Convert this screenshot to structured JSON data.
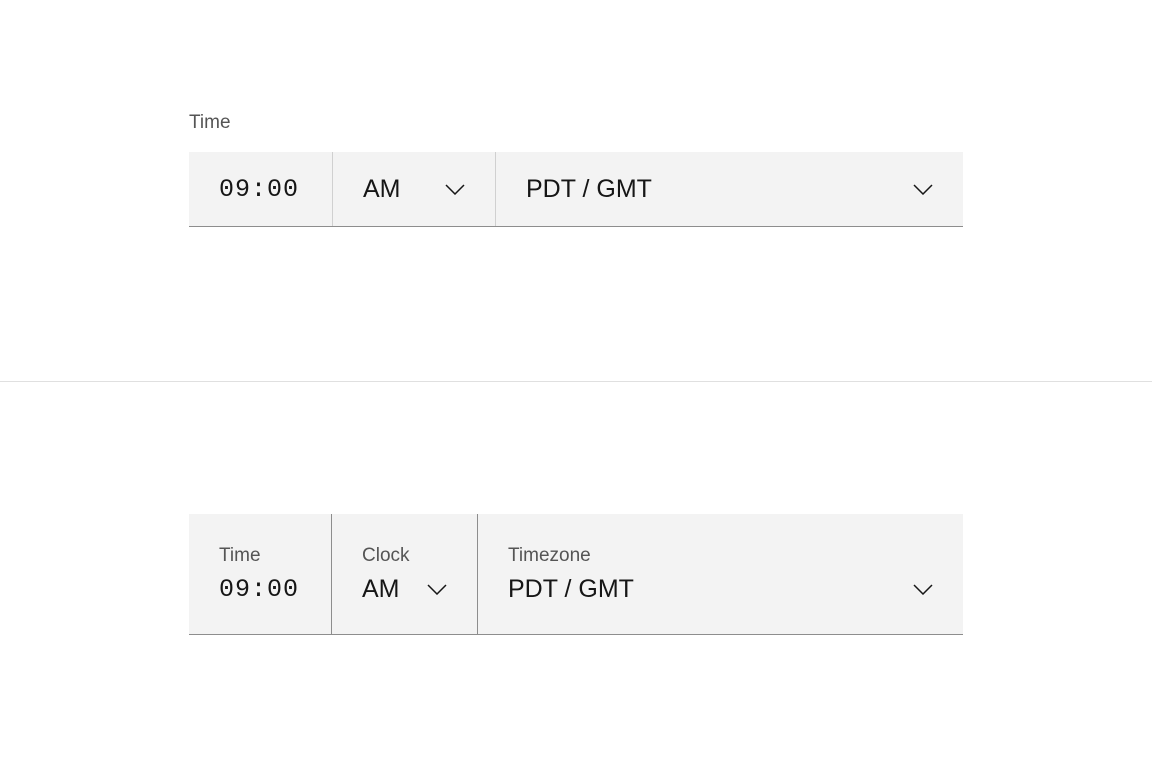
{
  "variant1": {
    "label": "Time",
    "time_value": "09:00",
    "period": "AM",
    "timezone": "PDT / GMT"
  },
  "variant2": {
    "labels": {
      "time": "Time",
      "clock": "Clock",
      "timezone": "Timezone"
    },
    "time_value": "09:00",
    "period": "AM",
    "timezone": "PDT / GMT"
  }
}
